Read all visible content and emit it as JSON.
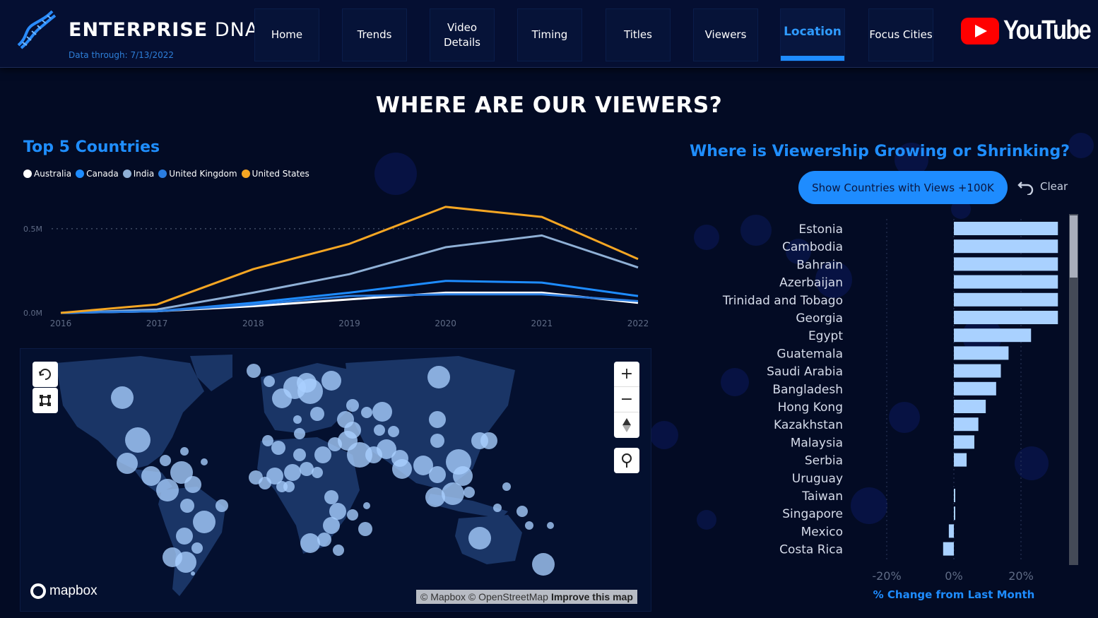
{
  "header": {
    "brand_bold": "ENTERPRISE",
    "brand_light": "DNA",
    "data_through": "Data through: 7/13/2022",
    "nav": [
      {
        "label": "Home"
      },
      {
        "label": "Trends"
      },
      {
        "label": "Video Details"
      },
      {
        "label": "Timing"
      },
      {
        "label": "Titles"
      },
      {
        "label": "Viewers"
      },
      {
        "label": "Location",
        "active": true
      },
      {
        "label": "Focus Cities"
      }
    ],
    "youtube_label": "YouTube"
  },
  "page_title": "WHERE ARE OUR VIEWERS?",
  "top_countries": {
    "title": "Top 5 Countries"
  },
  "growth": {
    "title": "Where is Viewership Growing or Shrinking?",
    "show_button": "Show Countries with Views +100K",
    "clear_label": "Clear"
  },
  "map": {
    "mapbox_label": "mapbox",
    "attribution": "© Mapbox © OpenStreetMap",
    "improve_link": "Improve this map",
    "zoom_in": "+",
    "zoom_out": "−"
  },
  "colors": {
    "accent": "#1e8cff",
    "background": "#030b24",
    "bar": "#a9d1ff",
    "australia": "#ffffff",
    "canada": "#1e8cff",
    "india": "#8fb0d6",
    "united_kingdom": "#2a7de1",
    "united_states": "#f5a623"
  },
  "chart_data": [
    {
      "type": "line",
      "title": "Top 5 Countries",
      "x": [
        "2016",
        "2017",
        "2018",
        "2019",
        "2020",
        "2021",
        "2022"
      ],
      "ylim": [
        0,
        0.6
      ],
      "yticks": [
        "0.0M",
        "0.5M"
      ],
      "series": [
        {
          "name": "Australia",
          "color": "#ffffff",
          "values": [
            0,
            0.01,
            0.04,
            0.08,
            0.12,
            0.12,
            0.06
          ]
        },
        {
          "name": "Canada",
          "color": "#1e8cff",
          "values": [
            0,
            0.01,
            0.06,
            0.12,
            0.19,
            0.18,
            0.1
          ]
        },
        {
          "name": "India",
          "color": "#8fb0d6",
          "values": [
            0,
            0.02,
            0.12,
            0.23,
            0.39,
            0.46,
            0.27
          ]
        },
        {
          "name": "United Kingdom",
          "color": "#2a7de1",
          "values": [
            0,
            0.01,
            0.05,
            0.1,
            0.11,
            0.11,
            0.07
          ]
        },
        {
          "name": "United States",
          "color": "#f5a623",
          "values": [
            0,
            0.05,
            0.26,
            0.41,
            0.63,
            0.57,
            0.32
          ]
        }
      ],
      "legend": "top-left",
      "grid": false
    },
    {
      "type": "bar",
      "title": "Where is Viewership Growing or Shrinking?",
      "xlabel": "% Change from Last Month",
      "xlim": [
        -26,
        34
      ],
      "xticks": [
        "-20%",
        "0%",
        "20%"
      ],
      "categories": [
        "Estonia",
        "Cambodia",
        "Bahrain",
        "Azerbaijan",
        "Trinidad and Tobago",
        "Georgia",
        "Egypt",
        "Guatemala",
        "Saudi Arabia",
        "Bangladesh",
        "Hong Kong",
        "Kazakhstan",
        "Malaysia",
        "Serbia",
        "Uruguay",
        "Taiwan",
        "Singapore",
        "Mexico",
        "Costa Rica"
      ],
      "values": [
        31,
        31,
        31,
        31,
        31,
        31,
        23,
        16.3,
        14,
        12.6,
        9.5,
        7.3,
        6.1,
        3.8,
        0,
        0.3,
        0.4,
        -1.5,
        -3.2
      ]
    }
  ]
}
